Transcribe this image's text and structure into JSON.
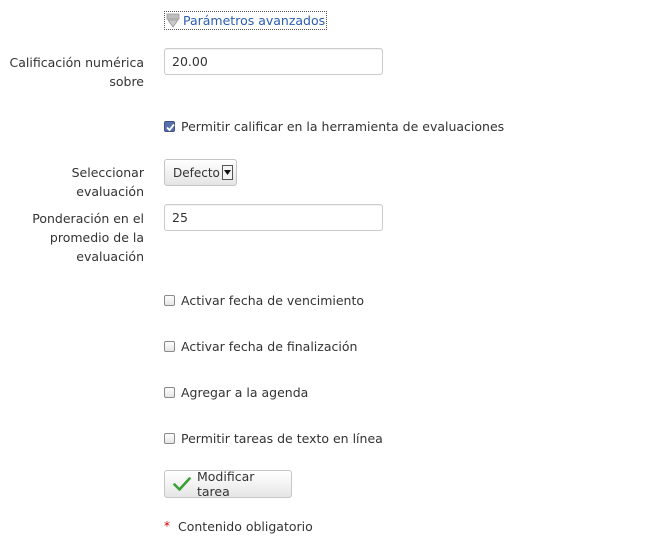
{
  "advanced": {
    "link_label": "Parámetros avanzados",
    "icon": "expand-arrow-icon"
  },
  "grade": {
    "label_line1": "Calificación numérica",
    "label_line2": "sobre",
    "value": "20.00"
  },
  "allow_grading": {
    "label": "Permitir calificar en la herramienta de evaluaciones",
    "checked": true
  },
  "evaluation": {
    "label": "Seleccionar evaluación",
    "selected": "Defecto"
  },
  "weight": {
    "label_line1": "Ponderación en el",
    "label_line2": "promedio de la",
    "label_line3": "evaluación",
    "value": "25"
  },
  "options": [
    {
      "label": "Activar fecha de vencimiento",
      "checked": false
    },
    {
      "label": "Activar fecha de finalización",
      "checked": false
    },
    {
      "label": "Agregar a la agenda",
      "checked": false
    },
    {
      "label": "Permitir tareas de texto en línea",
      "checked": false
    }
  ],
  "submit": {
    "label": "Modificar tarea",
    "icon": "checkmark-icon",
    "icon_color": "#3aa035"
  },
  "required": {
    "marker": "*",
    "text": "Contenido obligatorio",
    "marker_color": "#cc0000"
  }
}
